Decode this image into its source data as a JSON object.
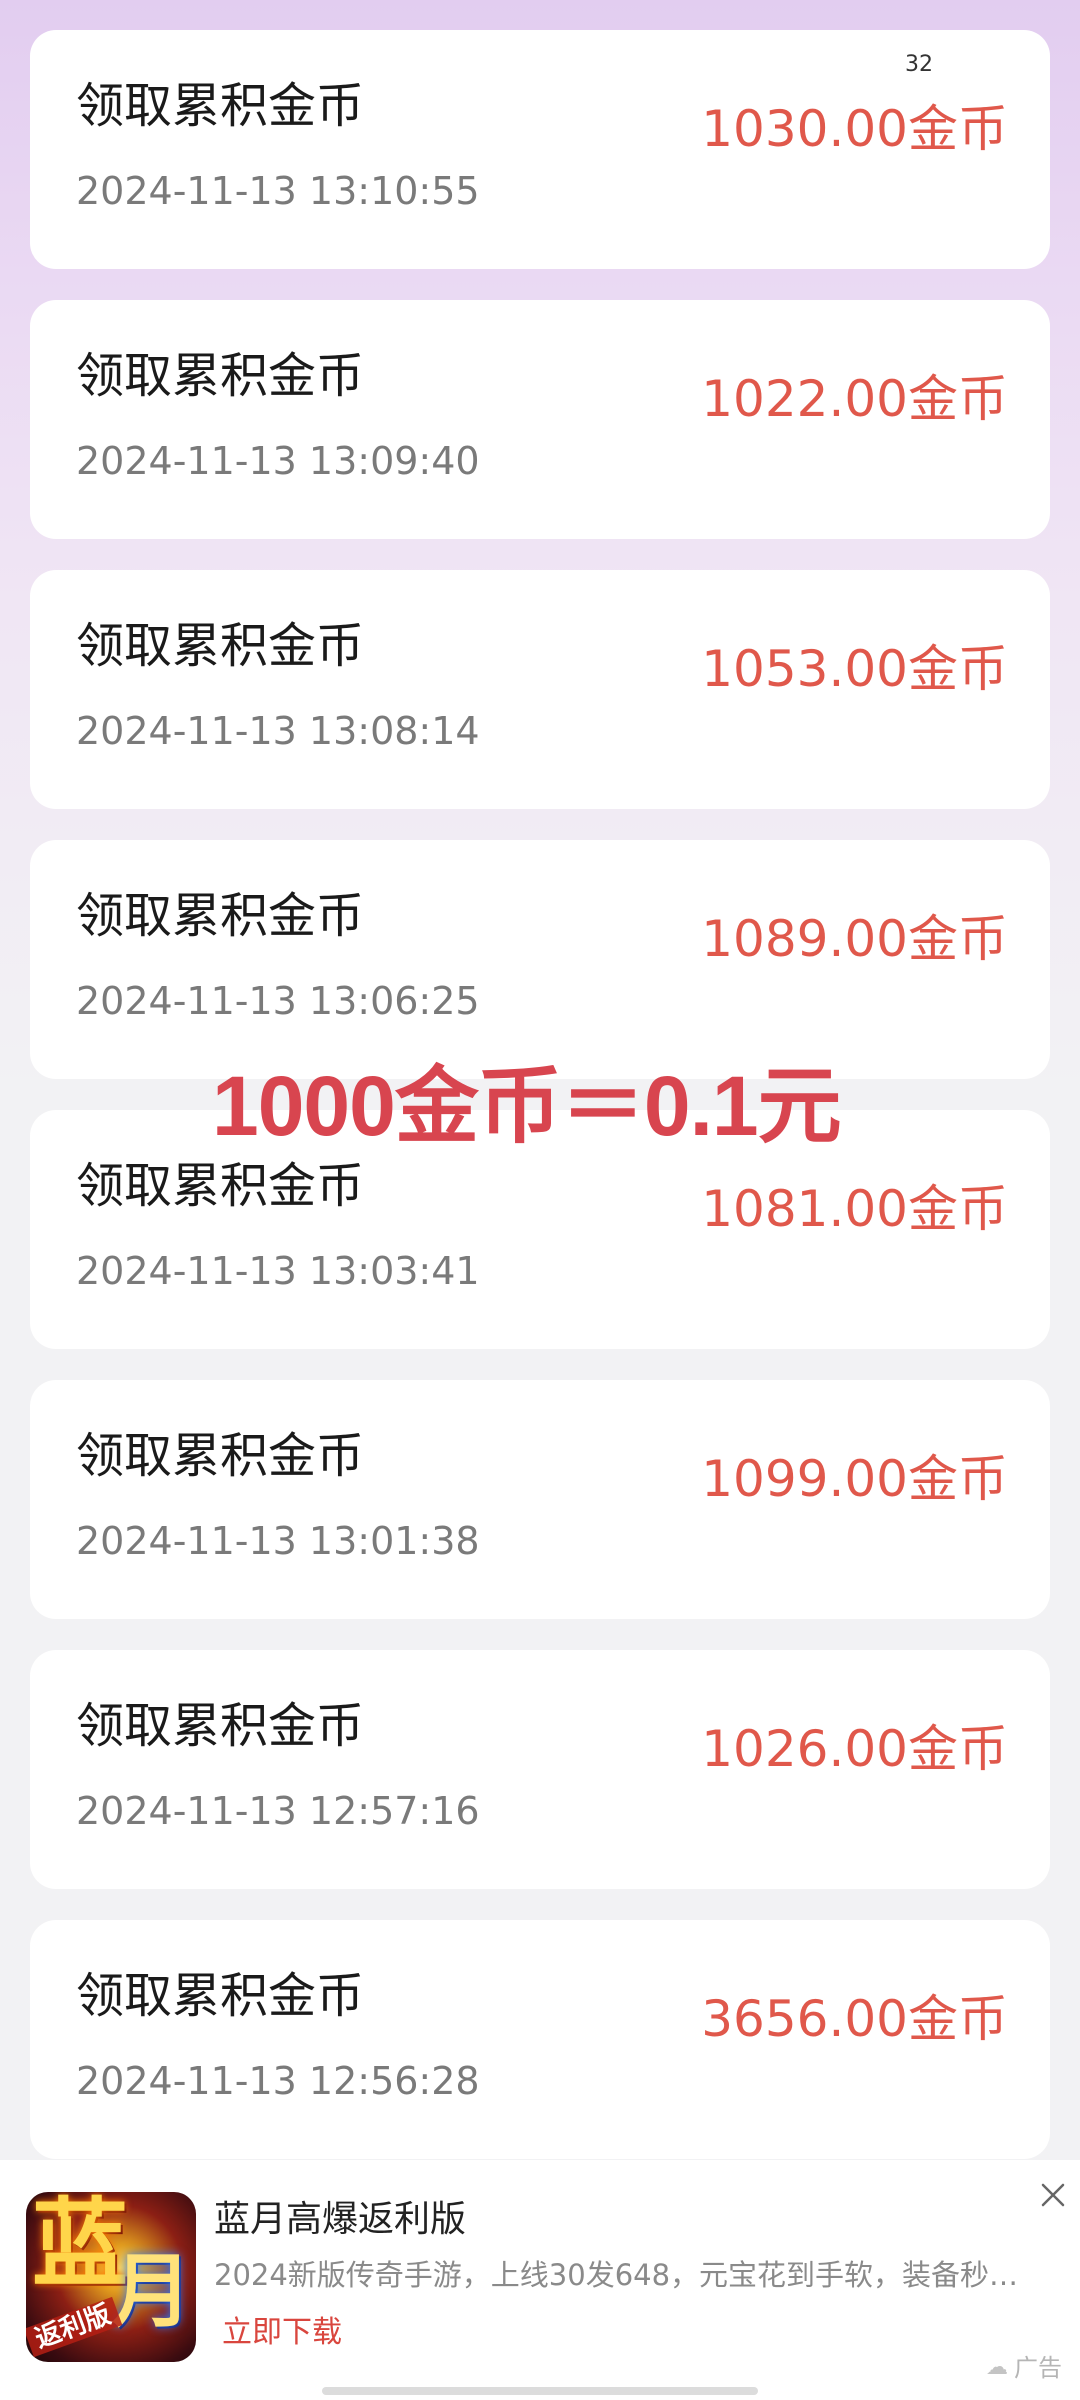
{
  "colors": {
    "amount": "#e0584b",
    "caption": "#d8454f",
    "download": "#d9463e"
  },
  "corner_number": "32",
  "records": [
    {
      "title": "领取累积金币",
      "time": "2024-11-13 13:10:55",
      "amount": "1030.00金币"
    },
    {
      "title": "领取累积金币",
      "time": "2024-11-13 13:09:40",
      "amount": "1022.00金币"
    },
    {
      "title": "领取累积金币",
      "time": "2024-11-13 13:08:14",
      "amount": "1053.00金币"
    },
    {
      "title": "领取累积金币",
      "time": "2024-11-13 13:06:25",
      "amount": "1089.00金币"
    },
    {
      "title": "领取累积金币",
      "time": "2024-11-13 13:03:41",
      "amount": "1081.00金币"
    },
    {
      "title": "领取累积金币",
      "time": "2024-11-13 13:01:38",
      "amount": "1099.00金币"
    },
    {
      "title": "领取累积金币",
      "time": "2024-11-13 12:57:16",
      "amount": "1026.00金币"
    },
    {
      "title": "领取累积金币",
      "time": "2024-11-13 12:56:28",
      "amount": "3656.00金币"
    }
  ],
  "overlay_caption": "1000金币＝0.1元",
  "ad": {
    "icon_glyph_1": "蓝",
    "icon_glyph_2": "月",
    "icon_tag": "返利版",
    "title": "蓝月高爆返利版",
    "description": "2024新版传奇手游，上线30发648，元宝花到手软，装备秒…",
    "download_label": "立即下载",
    "close_icon": "close-icon",
    "badge_label": "广告"
  }
}
